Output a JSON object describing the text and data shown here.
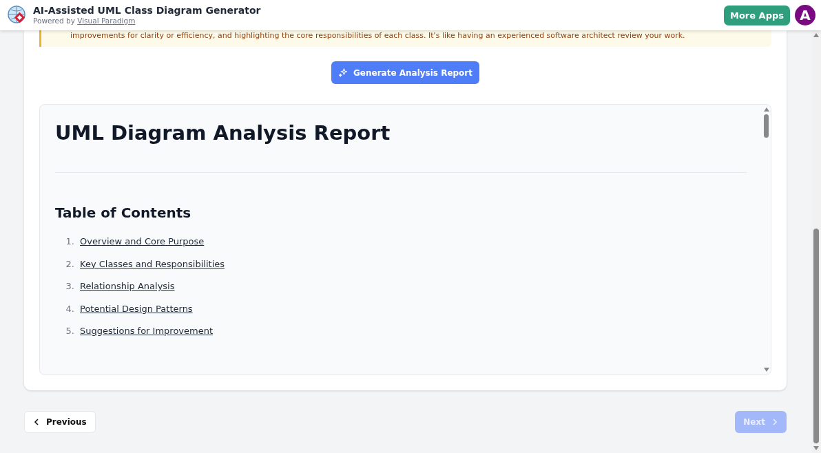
{
  "header": {
    "title": "AI-Assisted UML Class Diagram Generator",
    "powered_by": "Powered by",
    "powered_link": "Visual Paradigm",
    "more_apps": "More Apps",
    "avatar": "A"
  },
  "notice": {
    "text": "improvements for clarity or efficiency, and highlighting the core responsibilities of each class. It's like having an experienced software architect review your work."
  },
  "generate_button": {
    "label": "Generate Analysis Report"
  },
  "report": {
    "title": "UML Diagram Analysis Report",
    "toc_heading": "Table of Contents",
    "toc": [
      {
        "number": "1.",
        "label": "Overview and Core Purpose"
      },
      {
        "number": "2.",
        "label": "Key Classes and Responsibilities"
      },
      {
        "number": "3.",
        "label": "Relationship Analysis"
      },
      {
        "number": "4.",
        "label": "Potential Design Patterns"
      },
      {
        "number": "5.",
        "label": "Suggestions for Improvement"
      }
    ]
  },
  "navigation": [
    {
      "kind": "previous",
      "label": "Previous",
      "disabled": false
    },
    {
      "kind": "next",
      "label": "Next",
      "disabled": true
    }
  ]
}
